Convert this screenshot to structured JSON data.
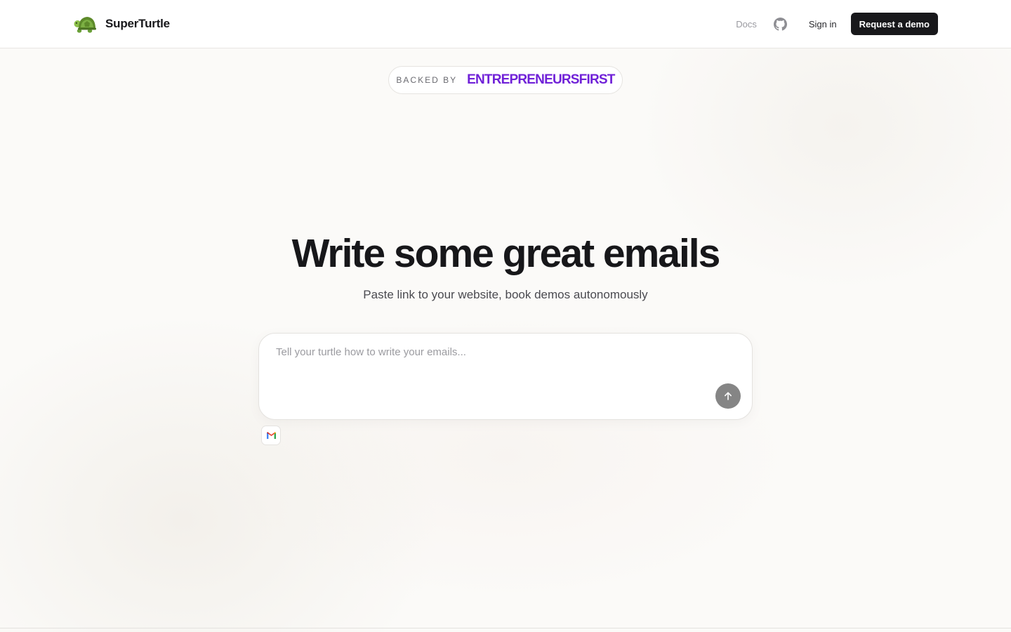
{
  "header": {
    "brand_name": "SuperTurtle",
    "logo_icon": "turtle-icon",
    "nav": {
      "docs_label": "Docs",
      "github_icon": "github-icon",
      "signin_label": "Sign in",
      "demo_label": "Request a demo"
    }
  },
  "backed": {
    "label": "BACKED BY",
    "brand": "ENTREPRENEURSFIRST"
  },
  "hero": {
    "title": "Write some great emails",
    "subtitle": "Paste link to your website, book demos autonomously"
  },
  "prompt": {
    "placeholder": "Tell your turtle how to write your emails...",
    "value": "",
    "send_icon": "arrow-up-icon"
  },
  "integrations": {
    "gmail_icon": "gmail-icon"
  },
  "colors": {
    "accent_purple": "#7021d8",
    "primary_button": "#18181b",
    "send_button": "#858585",
    "background": "#fbfaf8"
  }
}
